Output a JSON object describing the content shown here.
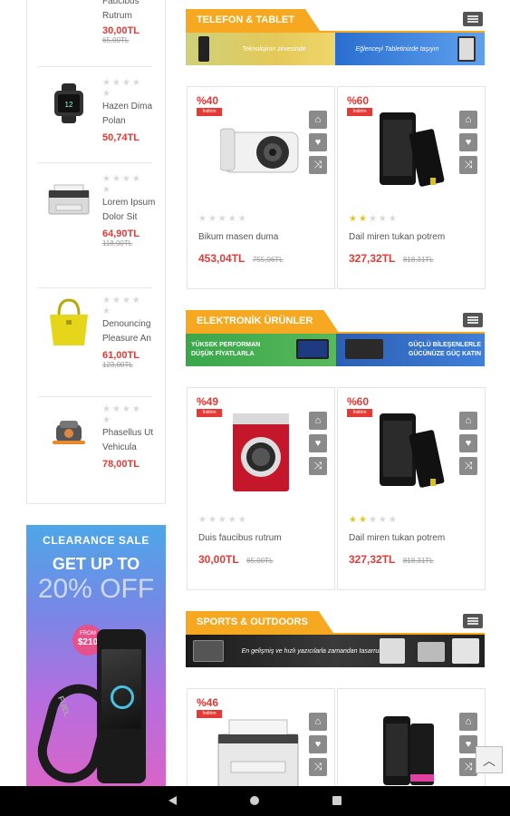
{
  "sidebar": {
    "items": [
      {
        "name": "Faucibus Rutrum",
        "price": "30,00TL",
        "old_price": "65,00TL",
        "icon": "product-image"
      },
      {
        "name": "Hazen Dima Polan",
        "price": "50,74TL",
        "old_price": "",
        "icon": "smartwatch-image"
      },
      {
        "name": "Lorem Ipsum Dolor Sit",
        "price": "64,90TL",
        "old_price": "118,00TL",
        "icon": "printer-image"
      },
      {
        "name": "Denouncing Pleasure An",
        "price": "61,00TL",
        "old_price": "123,00TL",
        "icon": "handbag-image"
      },
      {
        "name": "Phasellus Ut Vehicula",
        "price": "78,00TL",
        "old_price": "",
        "icon": "cooker-image"
      }
    ]
  },
  "promo": {
    "line1": "CLEARANCE SALE",
    "line2": "GET UP TO",
    "line3": "20% OFF",
    "from_label": "FROM",
    "from_price": "$210",
    "band_text": "FUEL"
  },
  "sections": [
    {
      "title": "TELEFON & TABLET",
      "banner_left": "Teknolojinin zirvesinde",
      "banner_right": "Eğlenceyi Tabletinizde taşıyın",
      "products": [
        {
          "discount": "%40",
          "tag": "İndirim",
          "name": "Bikum masen duma",
          "price": "453,04TL",
          "old_price": "755,06TL",
          "rating": 0,
          "icon": "camera-image"
        },
        {
          "discount": "%60",
          "tag": "İndirim",
          "name": "Dail miren tukan potrem",
          "price": "327,32TL",
          "old_price": "818,31TL",
          "rating": 2,
          "icon": "phone-image"
        }
      ]
    },
    {
      "title": "ELEKTRONİK ÜRÜNLER",
      "banner_left": "YÜKSEK PERFORMAN DÜŞÜK FİYATLARLA",
      "banner_right": "GÜÇLÜ BİLEŞENLERLE GÜCÜNÜZE GÜÇ KATIN",
      "products": [
        {
          "discount": "%49",
          "tag": "İndirim",
          "name": "Duis faucibus rutrum",
          "price": "30,00TL",
          "old_price": "65,00TL",
          "rating": 0,
          "icon": "washer-image"
        },
        {
          "discount": "%60",
          "tag": "İndirim",
          "name": "Dail miren tukan potrem",
          "price": "327,32TL",
          "old_price": "818,31TL",
          "rating": 2,
          "icon": "phone-image"
        }
      ]
    },
    {
      "title": "SPORTS & OUTDOORS",
      "banner_left": "En gelişmiş ve hızlı yazıcılarla zamandan tasarruf edin",
      "banner_right": "",
      "products": [
        {
          "discount": "%46",
          "tag": "İndirim",
          "icon": "printer-image"
        },
        {
          "discount": "",
          "tag": "",
          "icon": "phone-image"
        }
      ]
    }
  ],
  "icons": {
    "bag": "shopping-bag-icon",
    "heart": "heart-icon",
    "compare": "shuffle-icon",
    "to_top": "chevron-up-icon"
  },
  "colors": {
    "accent": "#f6a821",
    "price": "#e53935"
  }
}
